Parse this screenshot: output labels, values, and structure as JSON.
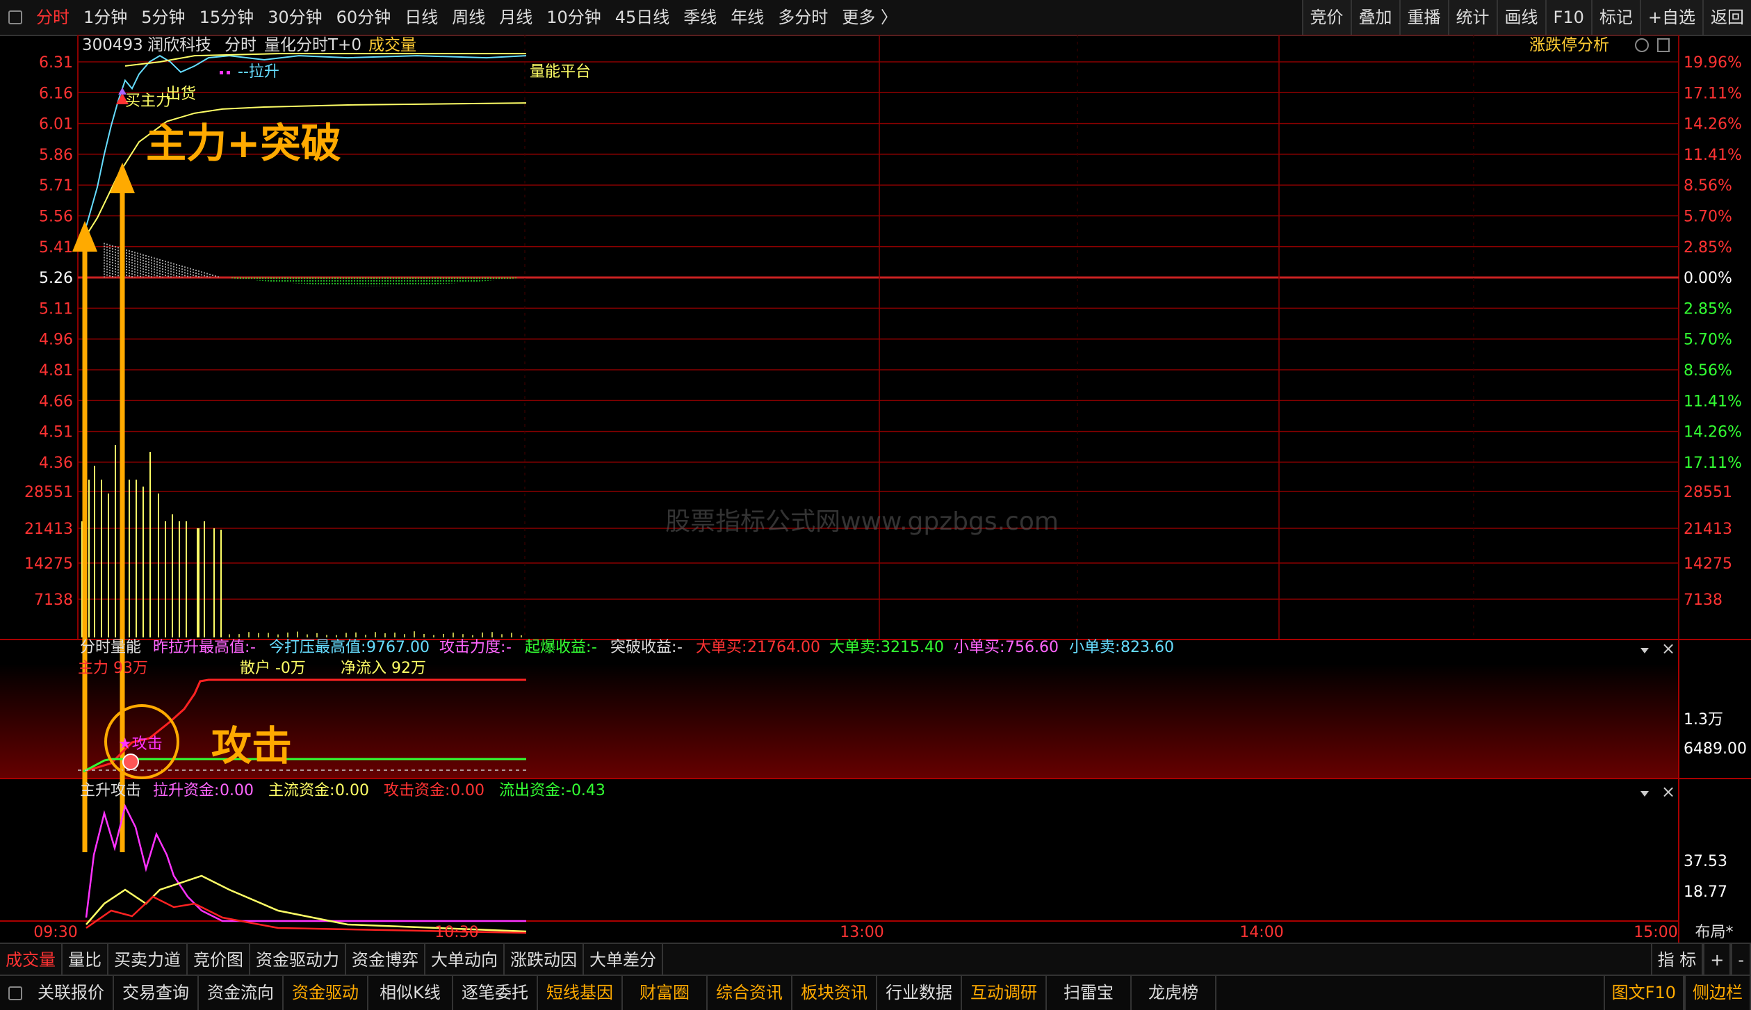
{
  "top_toolbar": {
    "timeframes": [
      "分时",
      "1分钟",
      "5分钟",
      "15分钟",
      "30分钟",
      "60分钟",
      "日线",
      "周线",
      "月线",
      "10分钟",
      "45日线",
      "季线",
      "年线",
      "多分时",
      "更多 〉"
    ],
    "active": 0,
    "right_buttons": [
      "竞价",
      "叠加",
      "重播",
      "统计",
      "画线",
      "F10",
      "标记",
      "+自选",
      "返回"
    ]
  },
  "header": {
    "code": "300493",
    "name": "润欣科技",
    "mode": "分时",
    "indicator": "量化分时T+0",
    "volume_label": "成交量",
    "analysis": "涨跌停分析",
    "legend_lashen": "--拉升",
    "legend_platform": "量能平台"
  },
  "price_axis": {
    "left": [
      "6.31",
      "6.16",
      "6.01",
      "5.86",
      "5.71",
      "5.56",
      "5.41",
      "5.26",
      "5.11",
      "4.96",
      "4.81",
      "4.66",
      "4.51",
      "4.36"
    ],
    "right": [
      "19.96%",
      "17.11%",
      "14.26%",
      "11.41%",
      "8.56%",
      "5.70%",
      "2.85%",
      "0.00%",
      "2.85%",
      "5.70%",
      "8.56%",
      "11.41%",
      "14.26%",
      "17.11%"
    ],
    "base": "5.26"
  },
  "volume_axis": {
    "left": [
      "28551",
      "21413",
      "14275",
      "7138"
    ],
    "right": [
      "28551",
      "21413",
      "14275",
      "7138"
    ]
  },
  "annotations": {
    "breakout": "主力+突破",
    "buy_main": "买主力",
    "sell": "出货",
    "attack": "攻击",
    "attack_star": "★攻击",
    "watermark": "股票指标公式网www.gpzbgs.com"
  },
  "panel1": {
    "title": "分时量能",
    "items": [
      {
        "label": "昨拉升最高值:",
        "value": "-"
      },
      {
        "label": "今打压最高值:",
        "value": "9767.00"
      },
      {
        "label": "攻击力度:",
        "value": "-"
      },
      {
        "label": "起爆收益:",
        "value": "-"
      },
      {
        "label": "突破收益:",
        "value": "-"
      },
      {
        "label": "大单买:",
        "value": "21764.00"
      },
      {
        "label": "大单卖:",
        "value": "3215.40"
      },
      {
        "label": "小单买:",
        "value": "756.60"
      },
      {
        "label": "小单卖:",
        "value": "823.60"
      }
    ],
    "sub": [
      {
        "label": "主力",
        "value": "93万"
      },
      {
        "label": "散户",
        "value": "-0万"
      },
      {
        "label": "净流入",
        "value": "92万"
      }
    ],
    "axis": [
      "1.3万",
      "6489.00"
    ]
  },
  "panel2": {
    "title": "主升攻击",
    "items": [
      {
        "label": "拉升资金:",
        "value": "0.00"
      },
      {
        "label": "主流资金:",
        "value": "0.00"
      },
      {
        "label": "攻击资金:",
        "value": "0.00"
      },
      {
        "label": "流出资金:",
        "value": "-0.43"
      }
    ],
    "axis": [
      "37.53",
      "18.77"
    ]
  },
  "time_axis": [
    "09:30",
    "10:30",
    "13:00",
    "14:00",
    "15:00"
  ],
  "layout_btn": "布局*",
  "tabs": [
    "成交量",
    "量比",
    "买卖力道",
    "竞价图",
    "资金驱动力",
    "资金博弈",
    "大单动向",
    "涨跌动因",
    "大单差分"
  ],
  "tabs_right": [
    "指 标",
    "+",
    "-"
  ],
  "bottom": [
    {
      "label": "关联报价",
      "orange": false
    },
    {
      "label": "交易查询",
      "orange": false
    },
    {
      "label": "资金流向",
      "orange": false
    },
    {
      "label": "资金驱动",
      "orange": true
    },
    {
      "label": "相似K线",
      "orange": false
    },
    {
      "label": "逐笔委托",
      "orange": false
    },
    {
      "label": "短线基因",
      "orange": true
    },
    {
      "label": "财富圈",
      "orange": true
    },
    {
      "label": "综合资讯",
      "orange": true
    },
    {
      "label": "板块资讯",
      "orange": true
    },
    {
      "label": "行业数据",
      "orange": false
    },
    {
      "label": "互动调研",
      "orange": true
    },
    {
      "label": "扫雷宝",
      "orange": false
    },
    {
      "label": "龙虎榜",
      "orange": false
    }
  ],
  "bottom_right": [
    "图文F10",
    "侧边栏"
  ],
  "colors": {
    "up": "#ff3333",
    "down": "#33ff33",
    "yellow": "#ffff66",
    "orange": "#ffaa00",
    "magenta": "#ff33ff",
    "cyan": "#66ddff",
    "grid": "#8b0000"
  }
}
